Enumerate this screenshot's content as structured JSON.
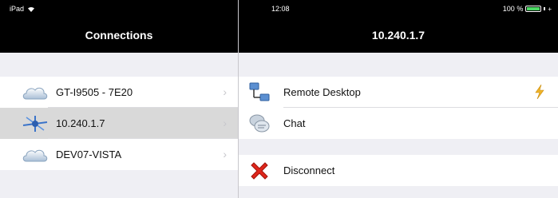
{
  "status_bar": {
    "device": "iPad",
    "time": "12:08",
    "battery": "100 %"
  },
  "master": {
    "title": "Connections",
    "items": [
      {
        "label": "GT-I9505 - 7E20",
        "icon": "cloud-icon",
        "selected": false
      },
      {
        "label": "10.240.1.7",
        "icon": "network-node-icon",
        "selected": true
      },
      {
        "label": "DEV07-VISTA",
        "icon": "cloud-icon",
        "selected": false
      }
    ]
  },
  "detail": {
    "title": "10.240.1.7",
    "actions": [
      {
        "label": "Remote Desktop",
        "icon": "remote-desktop-icon",
        "extra_icon": "lightning-icon"
      },
      {
        "label": "Chat",
        "icon": "chat-icon"
      }
    ],
    "disconnect": {
      "label": "Disconnect",
      "icon": "red-x-icon"
    }
  }
}
